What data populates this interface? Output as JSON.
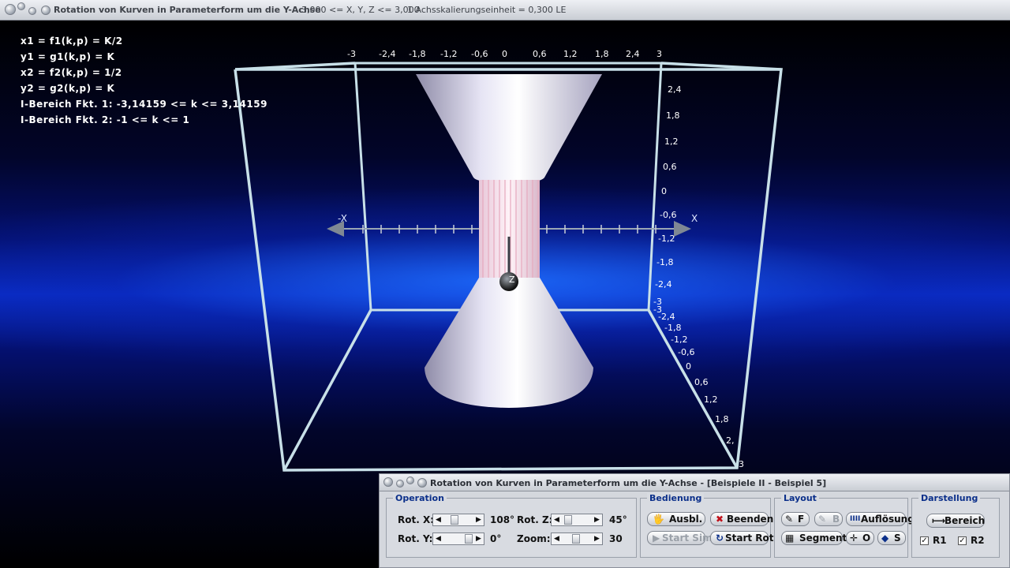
{
  "window": {
    "title": "Rotation von Kurven in Parameterform um die Y-Achse",
    "range": "-3,000 <= X, Y, Z <= 3,000",
    "scale": "1 Achsskalierungseinheit = 0,300 LE"
  },
  "formulas": [
    "x1 = f1(k,p) = K/2",
    "y1 = g1(k,p) = K",
    "x2 = f2(k,p) = 1/2",
    "y2 = g2(k,p) = K",
    "I-Bereich Fkt. 1: -3,14159 <= k <= 3,14159",
    "I-Bereich Fkt. 2: -1 <= k <= 1"
  ],
  "axes": {
    "top_ticks": [
      "-3",
      "-2,4",
      "-1,8",
      "-1,2",
      "-0,6",
      "0",
      "0,6",
      "1,2",
      "1,8",
      "2,4",
      "3"
    ],
    "right_ticks": [
      "2,4",
      "1,8",
      "1,2",
      "0,6",
      "0",
      "-0,6",
      "-1,2",
      "-1,8",
      "-2,4",
      "-3"
    ],
    "diag_ticks": [
      "-3",
      "-2,4",
      "-1,8",
      "-1,2",
      "-0,6",
      "0",
      "0,6",
      "1,2",
      "1,8",
      "2,",
      "3"
    ],
    "x_neg_label": "-X",
    "x_pos_label": "X",
    "z_label": "Z"
  },
  "panel": {
    "title": "Rotation von Kurven in Parameterform um die Y-Achse - [Beispiele II - Beispiel 5]",
    "operation": {
      "title": "Operation",
      "rot_x_label": "Rot. X:",
      "rot_x_value": "108°",
      "rot_y_label": "Rot. Y:",
      "rot_y_value": "0°",
      "rot_z_label": "Rot. Z:",
      "rot_z_value": "45°",
      "zoom_label": "Zoom:",
      "zoom_value": "30"
    },
    "bedienung": {
      "title": "Bedienung",
      "ausbl": "Ausbl.",
      "beenden": "Beenden",
      "start_sim": "Start Sim.",
      "start_rot": "Start Rot."
    },
    "layout": {
      "title": "Layout",
      "f": "F",
      "b": "B",
      "aufloesung": "Auflösung",
      "segment": "Segment",
      "o": "O",
      "s": "S"
    },
    "darstellung": {
      "title": "Darstellung",
      "bereich": "Bereich",
      "r1": "R1",
      "r2": "R2"
    }
  },
  "colors": {
    "frame": "#c8e0e8",
    "surface": "#d8d6ec",
    "stripe": "#f0b8c8"
  }
}
